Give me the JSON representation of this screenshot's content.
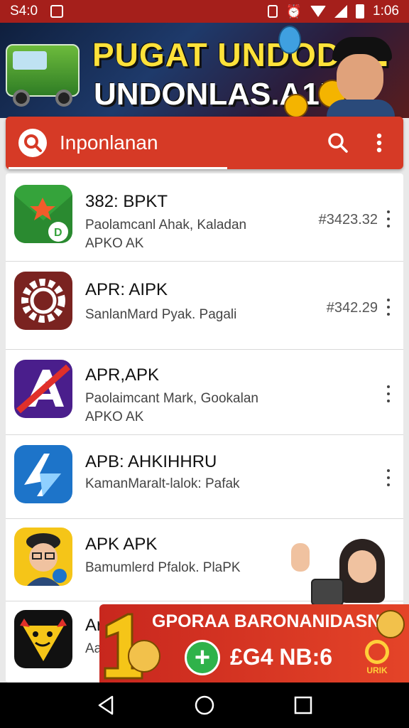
{
  "status_bar": {
    "time_left": "S4:0",
    "time_right": "1:06"
  },
  "banner": {
    "title_line1": "PUGAT UNDODAN",
    "title_line2": "UNDONLAS.A1”"
  },
  "app_bar": {
    "title": "Inponlanan"
  },
  "apps": [
    {
      "title": "382: BPKT",
      "subtitle": "Paolamcanl Ahak, Kaladan",
      "subtitle2": "APKO AK",
      "price": "#3423.32",
      "icon": "green-download-icon",
      "color": "#35a33b"
    },
    {
      "title": "APR: AIPK",
      "subtitle": "SanlanMard Pyak. Pagali",
      "subtitle2": "",
      "price": "#342.29",
      "icon": "gear-icon",
      "color": "#7a2320"
    },
    {
      "title": "APR,APK",
      "subtitle": "Paolaimcant Mark, Gookalan",
      "subtitle2": "APKO AK",
      "price": "",
      "icon": "slash-a-icon",
      "color": "#4a1e8c"
    },
    {
      "title": "APB: AHKIHHRU",
      "subtitle": "KamanMaralt-lalok: Pafak",
      "subtitle2": "",
      "price": "",
      "icon": "arrow-icon",
      "color": "#1d74c9"
    },
    {
      "title": "APK APK",
      "subtitle": "Bamumlerd Pfalok. PlaPK",
      "subtitle2": "",
      "price": "",
      "icon": "officer-avatar-icon",
      "color": "#f5c518"
    },
    {
      "title": "Ar",
      "subtitle": "Aa",
      "subtitle2": "",
      "price": "",
      "icon": "yellow-face-icon",
      "color": "#111111"
    }
  ],
  "promo": {
    "title": "GPORAA BARONANIDASN",
    "code": "£G4 NB:6",
    "logo_text": "URIK"
  }
}
